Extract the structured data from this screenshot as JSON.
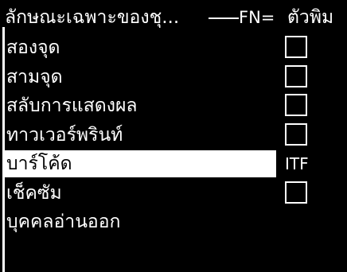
{
  "header": {
    "title": "ลักษณะเฉพาะของชุ...",
    "fn_label": "FN=",
    "right_text": "ตัวพิม"
  },
  "menu": {
    "items": [
      {
        "label": "สองจุด",
        "control": "checkbox"
      },
      {
        "label": "สามจุด",
        "control": "checkbox"
      },
      {
        "label": "สลับการแสดงผล",
        "control": "checkbox"
      },
      {
        "label": "ทาวเวอร์พรินท์",
        "control": "checkbox"
      },
      {
        "label": "บาร์โค้ด",
        "control": "value",
        "value": "ITF",
        "selected": true
      },
      {
        "label": "เช็คซัม",
        "control": "checkbox"
      },
      {
        "label": "บุคคลอ่านออก",
        "control": "none"
      }
    ]
  },
  "colors": {
    "background": "#000000",
    "foreground": "#ffffff",
    "highlight": "#ffffff"
  }
}
